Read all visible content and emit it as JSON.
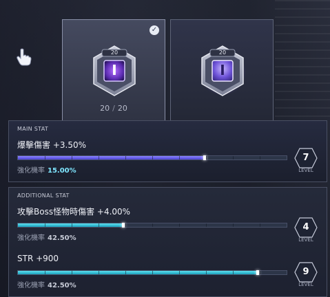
{
  "cards": [
    {
      "tier": "20",
      "glyph": "Ⅰ",
      "current": "20",
      "max": "20",
      "selected": true
    },
    {
      "tier": "20",
      "glyph": "Ⅰ",
      "selected": false
    }
  ],
  "main_stat": {
    "header": "MAIN STAT",
    "name": "爆擊傷害 +3.50%",
    "progress": 0.697,
    "rate_label": "強化機率",
    "rate_value": "15.00%",
    "level": "7",
    "level_caption": "LEVEL"
  },
  "additional_stat": {
    "header": "ADDITIONAL STAT",
    "items": [
      {
        "name": "攻擊Boss怪物時傷害 +4.00%",
        "progress": 0.395,
        "rate_label": "強化機率",
        "rate_value": "42.50%",
        "level": "4",
        "level_caption": "LEVEL"
      },
      {
        "name": "STR +900",
        "progress": 0.895,
        "rate_label": "強化機率",
        "rate_value": "42.50%",
        "level": "9",
        "level_caption": "LEVEL"
      }
    ]
  },
  "colors": {
    "main_bar": "#6a63f0",
    "additional_bar": "#2fc3dc",
    "rate_highlight": "#7fe6ff"
  }
}
